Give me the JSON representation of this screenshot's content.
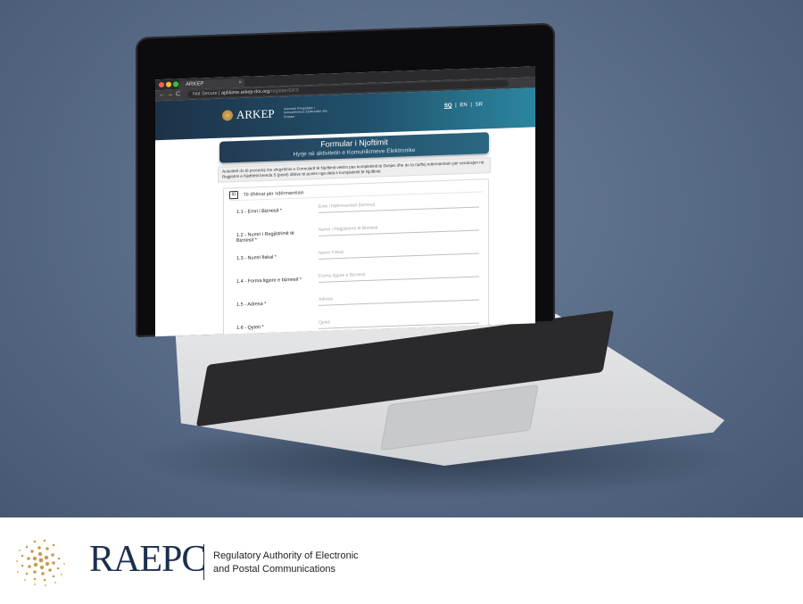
{
  "browser": {
    "tab_title": "ARKEP",
    "tab_close": "×",
    "nav_back": "←",
    "nav_forward": "→",
    "nav_reload": "C",
    "security_label": "Not Secure",
    "url_host": "aplikime.arkep-rks.org",
    "url_path": "/register/GFS"
  },
  "site": {
    "logo_name": "ARKEP",
    "logo_sub": "Autoriteti Rregullator i Komunikimeve Elektronike dhe Postare",
    "languages": [
      "SQ",
      "EN",
      "SR"
    ],
    "lang_separator": "|"
  },
  "form": {
    "title": "Formular i Njoftimit",
    "subtitle": "Hyrje në aktivitetin e Komunikimeve Elektronike",
    "notice": "Autoriteti do të procedoj me shqyrtimin e Formularit të Njoftimit vetëm pas kompletimit të Dosjes dhe do ta njoftoj ndërmarrësin për vendosjen në Regjistrin e Njoftimit brenda 5 (pesë) ditëve të punës nga data e kompletimit të Njoftimit.",
    "section_icon": "ID",
    "section_title": "Të dhënat për ndërmarrësin",
    "fields": [
      {
        "label": "1.1 - Emri i Biznesit *",
        "placeholder": "Emri i Ndërmarrësit (biznesi)"
      },
      {
        "label": "1.2 - Numri i Regjistrimit të Biznesit *",
        "placeholder": "Numri i Regjistrimit të Biznesit"
      },
      {
        "label": "1.3 - Numri fiskal *",
        "placeholder": "Numri Fiskal"
      },
      {
        "label": "1.4 - Forma ligjore e biznesit *",
        "placeholder": "Forma ligjore e Biznesit"
      },
      {
        "label": "1.5 - Adresa *",
        "placeholder": "Adresa"
      },
      {
        "label": "1.6 - Qyteti *",
        "placeholder": "Qyteti"
      }
    ]
  },
  "footer": {
    "brand": "RAEPC",
    "description_line1": "Regulatory Authority of Electronic",
    "description_line2": "and Postal Communications"
  },
  "colors": {
    "background": "#566985",
    "brand_navy": "#1c2f4f",
    "header_dark": "#1d3248",
    "header_light": "#2b86a0",
    "gold": "#c99a4e"
  }
}
